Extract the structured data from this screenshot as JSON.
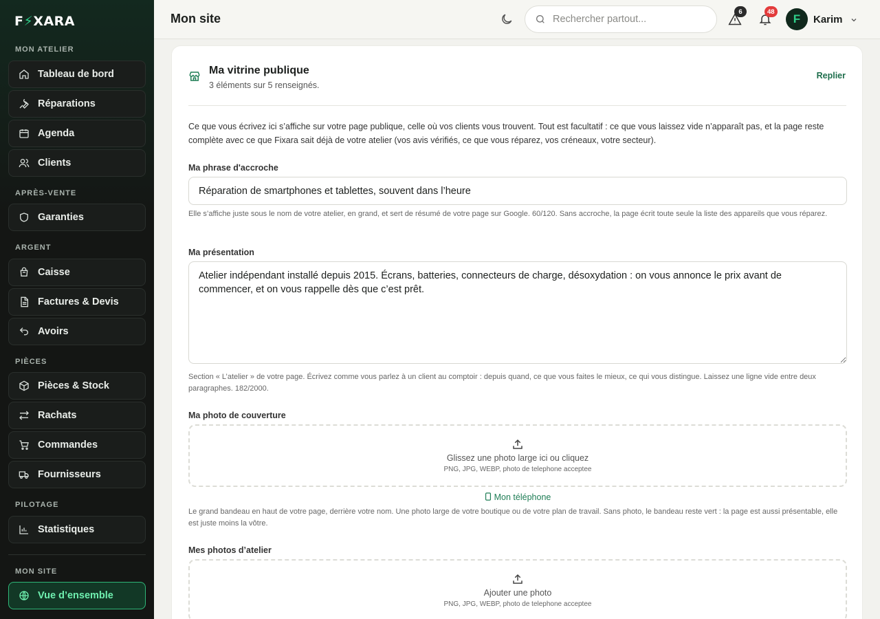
{
  "brand": {
    "logo_pre": "F",
    "logo_bolt": "⚡",
    "logo_post": "XARA"
  },
  "sidebar": {
    "sections": [
      {
        "title": "MON ATELIER"
      },
      {
        "title": "APRÈS-VENTE"
      },
      {
        "title": "ARGENT"
      },
      {
        "title": "PIÈCES"
      },
      {
        "title": "PILOTAGE"
      },
      {
        "title": "MON SITE"
      }
    ],
    "items": [
      {
        "label": "Tableau de bord",
        "icon": "home-icon"
      },
      {
        "label": "Réparations",
        "icon": "wrench-icon"
      },
      {
        "label": "Agenda",
        "icon": "calendar-icon"
      },
      {
        "label": "Clients",
        "icon": "users-icon"
      },
      {
        "label": "Garanties",
        "icon": "shield-icon"
      },
      {
        "label": "Caisse",
        "icon": "cash-register-icon"
      },
      {
        "label": "Factures & Devis",
        "icon": "document-icon"
      },
      {
        "label": "Avoirs",
        "icon": "undo-icon"
      },
      {
        "label": "Pièces & Stock",
        "icon": "package-icon"
      },
      {
        "label": "Rachats",
        "icon": "swap-icon"
      },
      {
        "label": "Commandes",
        "icon": "cart-icon"
      },
      {
        "label": "Fournisseurs",
        "icon": "truck-icon"
      },
      {
        "label": "Statistiques",
        "icon": "bar-chart-icon"
      },
      {
        "label": "Vue d’ensemble",
        "icon": "globe-icon",
        "active": true
      }
    ]
  },
  "header": {
    "title": "Mon site",
    "search_placeholder": "Rechercher partout...",
    "alerts_count": "6",
    "notifications_count": "48",
    "user_initial": "F",
    "user_name": "Karim"
  },
  "card": {
    "title": "Ma vitrine publique",
    "subtitle": "3 éléments sur 5 renseignés.",
    "collapse_label": "Replier",
    "intro": "Ce que vous écrivez ici s’affiche sur votre page publique, celle où vos clients vous trouvent. Tout est facultatif : ce que vous laissez vide n’apparaît pas, et la page reste complète avec ce que Fixara sait déjà de votre atelier (vos avis vérifiés, ce que vous réparez, vos créneaux, votre secteur).",
    "tagline": {
      "label": "Ma phrase d'accroche",
      "value": "Réparation de smartphones et tablettes, souvent dans l’heure",
      "help": "Elle s’affiche juste sous le nom de votre atelier, en grand, et sert de résumé de votre page sur Google. 60/120. Sans accroche, la page écrit toute seule la liste des appareils que vous réparez."
    },
    "presentation": {
      "label": "Ma présentation",
      "value": "Atelier indépendant installé depuis 2015. Écrans, batteries, connecteurs de charge, désoxydation : on vous annonce le prix avant de commencer, et on vous rappelle dès que c’est prêt.",
      "help": "Section « L’atelier » de votre page. Écrivez comme vous parlez à un client au comptoir : depuis quand, ce que vous faites le mieux, ce qui vous distingue. Laissez une ligne vide entre deux paragraphes. 182/2000."
    },
    "cover": {
      "label": "Ma photo de couverture",
      "drop_main": "Glissez une photo large ici ou cliquez",
      "drop_sub": "PNG, JPG, WEBP, photo de telephone acceptee",
      "phone_link": "Mon téléphone",
      "help": "Le grand bandeau en haut de votre page, derrière votre nom. Une photo large de votre boutique ou de votre plan de travail. Sans photo, le bandeau reste vert : la page est aussi présentable, elle est juste moins la vôtre."
    },
    "workshop_photos": {
      "label": "Mes photos d’atelier",
      "drop_main": "Ajouter une photo",
      "drop_sub": "PNG, JPG, WEBP, photo de telephone acceptee"
    }
  }
}
